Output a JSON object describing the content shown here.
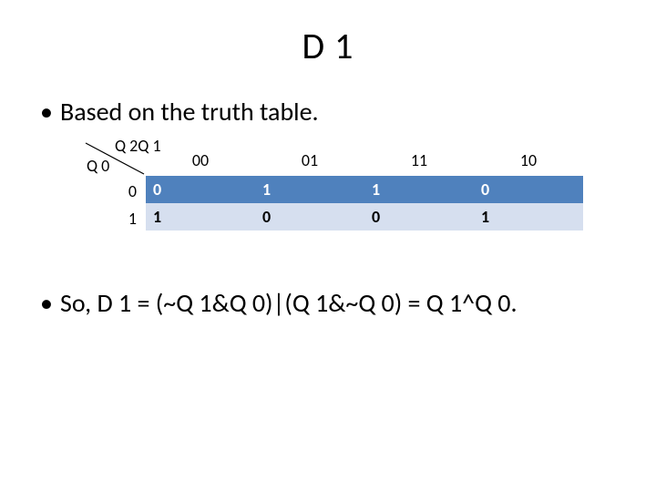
{
  "title": "D 1",
  "bullet1": "Based on the truth table.",
  "bullet2": "So, D 1 = (~Q 1&Q 0)|(Q 1&~Q 0) = Q 1^Q 0.",
  "kmap": {
    "col_axis": "Q 2Q 1",
    "row_axis": "Q 0",
    "col_headers": [
      "00",
      "01",
      "11",
      "10"
    ],
    "row_headers": [
      "0",
      "1"
    ],
    "rows": [
      [
        "0",
        "1",
        "1",
        "0"
      ],
      [
        "1",
        "0",
        "0",
        "1"
      ]
    ]
  },
  "chart_data": {
    "type": "table",
    "title": "D1 Karnaugh map",
    "col_variable": "Q2Q1",
    "row_variable": "Q0",
    "columns": [
      "00",
      "01",
      "11",
      "10"
    ],
    "rows": [
      "0",
      "1"
    ],
    "values": [
      [
        0,
        1,
        1,
        0
      ],
      [
        1,
        0,
        0,
        1
      ]
    ],
    "expression": "D1 = (~Q1 & Q0) | (Q1 & ~Q0) = Q1 ^ Q0"
  }
}
